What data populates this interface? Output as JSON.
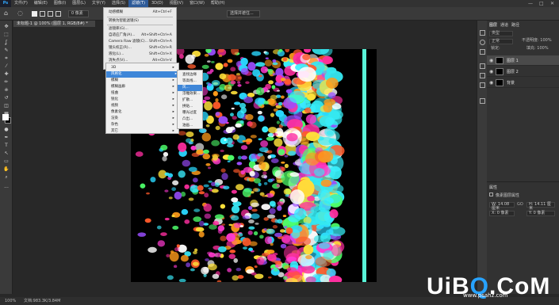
{
  "app": {
    "logo": "Ps"
  },
  "menubar": {
    "items": [
      "文件(F)",
      "编辑(E)",
      "图像(I)",
      "图层(L)",
      "文字(Y)",
      "选择(S)",
      "滤镜(T)",
      "3D(D)",
      "视图(V)",
      "窗口(W)",
      "帮助(H)"
    ],
    "active_index": 6
  },
  "window_controls": {
    "minimize": "—",
    "maximize": "□",
    "close": "✕"
  },
  "options_bar": {
    "select_value": "0 像素",
    "button_label": "选择并遮住..."
  },
  "document_tab": {
    "label": "未标题-1 @ 100% (图层 1, RGB/8#) *"
  },
  "filter_menu": {
    "items": [
      {
        "label": "动感模糊",
        "shortcut": "Alt+Ctrl+F"
      },
      {
        "label": "转换为智能滤镜(S)",
        "shortcut": ""
      },
      {
        "label": "滤镜库(G)...",
        "shortcut": ""
      },
      {
        "label": "自适应广角(A)...",
        "shortcut": "Alt+Shift+Ctrl+A"
      },
      {
        "label": "Camera Raw 滤镜(C)...",
        "shortcut": "Shift+Ctrl+A"
      },
      {
        "label": "镜头校正(R)...",
        "shortcut": "Shift+Ctrl+R"
      },
      {
        "label": "液化(L)...",
        "shortcut": "Shift+Ctrl+X"
      },
      {
        "label": "消失点(V)...",
        "shortcut": "Alt+Ctrl+V"
      }
    ]
  },
  "filter_submenu": {
    "items": [
      "3D",
      "风格化",
      "模糊",
      "模糊画廊",
      "扭曲",
      "锐化",
      "视频",
      "像素化",
      "渲染",
      "杂色",
      "其它"
    ],
    "highlight_index": 1
  },
  "stylize_submenu": {
    "items": [
      "查找边缘",
      "等高线...",
      "风...",
      "浮雕效果...",
      "扩散...",
      "拼贴...",
      "曝光过度",
      "凸出...",
      "油画..."
    ],
    "highlight_index": 2
  },
  "toolbar": {
    "tools": [
      "move-icon",
      "marquee-icon",
      "lasso-icon",
      "quick-select-icon",
      "crop-icon",
      "eyedropper-icon",
      "healing-icon",
      "brush-icon",
      "stamp-icon",
      "history-brush-icon",
      "eraser-icon",
      "gradient-icon",
      "blur-icon",
      "dodge-icon",
      "pen-icon",
      "type-icon",
      "path-select-icon",
      "shape-icon",
      "hand-icon",
      "zoom-icon"
    ],
    "more": "...",
    "foreground": "#ffffff",
    "background": "#000000"
  },
  "layers_panel": {
    "tabs": [
      "图层",
      "通道",
      "路径"
    ],
    "kind_select": "类型",
    "blend_mode": "正常",
    "opacity": "不透明度: 100%",
    "lock": "锁定:",
    "fill": "填充: 100%",
    "layers": [
      {
        "name": "图层 1",
        "selected": true
      },
      {
        "name": "图层 2",
        "selected": false
      },
      {
        "name": "背景",
        "selected": false
      }
    ]
  },
  "properties_panel": {
    "title": "属性",
    "subtitle": "像素图层属性",
    "w": "W: 14.08 厘米",
    "h": "H: 14.11 厘米",
    "x": "X: 0 像素",
    "y": "Y: 0 像素",
    "go": "GO"
  },
  "statusbar": {
    "zoom": "100%",
    "info": "文档:983.3K/3.84M"
  },
  "watermark": {
    "brand": "UiBQ.CoM",
    "url": "www.psahz.com"
  },
  "colors": {
    "accent": "#2d5a98",
    "menu_highlight": "#3e86d8",
    "cyan_stripe": "#58f3d8"
  }
}
